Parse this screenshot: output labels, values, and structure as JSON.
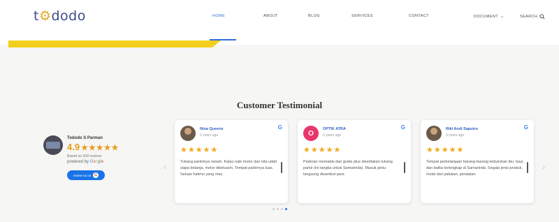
{
  "header": {
    "logo_mark": "t",
    "logo_icon": "⚙",
    "logo_rest": "dodo",
    "nav": [
      {
        "label": "HOME",
        "active": true
      },
      {
        "label": "ABOUT"
      },
      {
        "label": "BLOG"
      },
      {
        "label": "SERVICES"
      },
      {
        "label": "CONTACT"
      },
      {
        "label": "DOCUMENT",
        "has_dropdown": true
      }
    ],
    "search_label": "SEARCH"
  },
  "section_title": "Customer Testimonial",
  "summary": {
    "name": "Tododo S Parman",
    "rating": "4.9",
    "stars": "★★★★★",
    "based_on": "Based on 339 reviews",
    "powered_prefix": "powered by ",
    "google": [
      "G",
      "o",
      "o",
      "g",
      "l",
      "e"
    ],
    "review_button": "review us on"
  },
  "reviews": [
    {
      "name": "Nina Queens",
      "time": "3 years ago",
      "stars": "★★★★★",
      "text": "Tukang parkirnya ramah. Kalau naik motor dan kita udah siapa belanja, motor diketuarin. Tempat parkirnya luas. Seluas hatimu yang mau"
    },
    {
      "name": "OPTIK ATRA",
      "initial": "O",
      "time": "3 years ago",
      "stars": "★★★★★",
      "text": "Parkiran memadai dan gratis plus disediakan tukang parkir (ini langka untuk Samarinda). Masuk pintu langsung disambut para"
    },
    {
      "name": "Rikl Andi Saputro",
      "time": "3 years ago",
      "stars": "★★★★★",
      "text": "Tempat perbelanjaan barang-barang kebutuhan ibu, bayi, dan balita terlengkap di Samarinda. Segala jenis produk, mulai dari pakaian, peralatan"
    }
  ],
  "carousel": {
    "prev": "‹",
    "next": "›",
    "page_count": 4,
    "active_page": 4
  },
  "colors": {
    "accent": "#2e6fd8",
    "yellow": "#f2cf1f",
    "star": "#f0a81a"
  }
}
